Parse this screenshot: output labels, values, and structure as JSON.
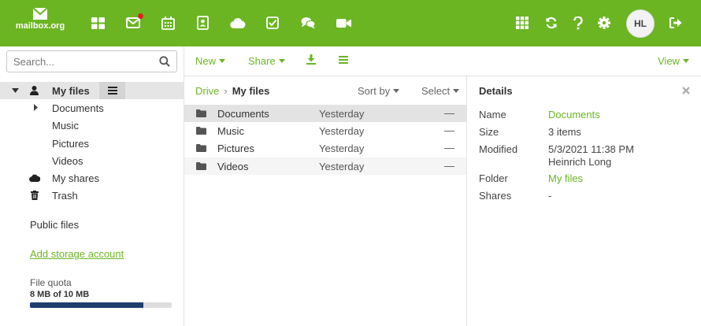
{
  "app": {
    "name": "mailbox.org"
  },
  "topbar": {
    "icons": [
      "apps-grid-icon",
      "mail-icon",
      "calendar-icon",
      "contacts-icon",
      "drive-cloud-icon",
      "tasks-icon",
      "chat-icon",
      "video-icon"
    ],
    "right_icons": [
      "launcher-grid-icon",
      "refresh-icon",
      "help-icon",
      "settings-icon",
      "logout-icon"
    ],
    "avatar_initials": "HL",
    "brand_color": "#6bb522",
    "notification_color": "#e02020"
  },
  "sidebar": {
    "search_placeholder": "Search...",
    "tree": {
      "my_files": "My files",
      "children": [
        "Documents",
        "Music",
        "Pictures",
        "Videos"
      ],
      "my_shares": "My shares",
      "trash": "Trash"
    },
    "public_files": "Public files",
    "add_storage": "Add storage account",
    "quota": {
      "label": "File quota",
      "value": "8 MB of 10 MB",
      "fraction": 0.8
    }
  },
  "toolbar": {
    "new": "New",
    "share": "Share",
    "view": "View"
  },
  "breadcrumb": {
    "root": "Drive",
    "sep": "›",
    "current": "My files"
  },
  "list": {
    "sort_by": "Sort by",
    "select": "Select",
    "rows": [
      {
        "name": "Documents",
        "date": "Yesterday",
        "size": "—"
      },
      {
        "name": "Music",
        "date": "Yesterday",
        "size": "—"
      },
      {
        "name": "Pictures",
        "date": "Yesterday",
        "size": "—"
      },
      {
        "name": "Videos",
        "date": "Yesterday",
        "size": "—"
      }
    ]
  },
  "details": {
    "title": "Details",
    "name_label": "Name",
    "name_value": "Documents",
    "size_label": "Size",
    "size_value": "3 items",
    "modified_label": "Modified",
    "modified_value": "5/3/2021 11:38 PM",
    "modified_by": "Heinrich Long",
    "folder_label": "Folder",
    "folder_value": "My files",
    "shares_label": "Shares",
    "shares_value": "-"
  }
}
